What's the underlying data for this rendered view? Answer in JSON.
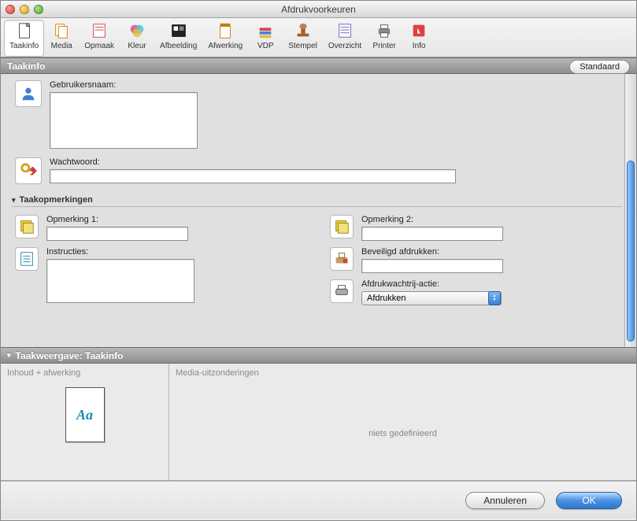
{
  "window": {
    "title": "Afdrukvoorkeuren"
  },
  "toolbar": {
    "items": [
      {
        "label": "Taakinfo"
      },
      {
        "label": "Media"
      },
      {
        "label": "Opmaak"
      },
      {
        "label": "Kleur"
      },
      {
        "label": "Afbeelding"
      },
      {
        "label": "Afwerking"
      },
      {
        "label": "VDP"
      },
      {
        "label": "Stempel"
      },
      {
        "label": "Overzicht"
      },
      {
        "label": "Printer"
      },
      {
        "label": "Info"
      }
    ]
  },
  "section": {
    "title": "Taakinfo",
    "standard_button": "Standaard"
  },
  "fields": {
    "username_label": "Gebruikersnaam:",
    "username_value": "",
    "password_label": "Wachtwoord:",
    "password_value": ""
  },
  "subsection": {
    "title": "Taakopmerkingen"
  },
  "remarks": {
    "r1_label": "Opmerking 1:",
    "r1_value": "",
    "r2_label": "Opmerking 2:",
    "r2_value": "",
    "instr_label": "Instructies:",
    "instr_value": "",
    "secure_label": "Beveiligd afdrukken:",
    "secure_value": "",
    "queue_label": "Afdrukwachtrij-actie:",
    "queue_value": "Afdrukken"
  },
  "preview_section": {
    "title": "Taakweergave: Taakinfo"
  },
  "preview": {
    "col1_header": "Inhoud + afwerking",
    "thumb_text": "Aa",
    "col2_header": "Media-uitzonderingen",
    "empty_text": "niets gedefinieerd"
  },
  "buttons": {
    "cancel": "Annuleren",
    "ok": "OK"
  }
}
